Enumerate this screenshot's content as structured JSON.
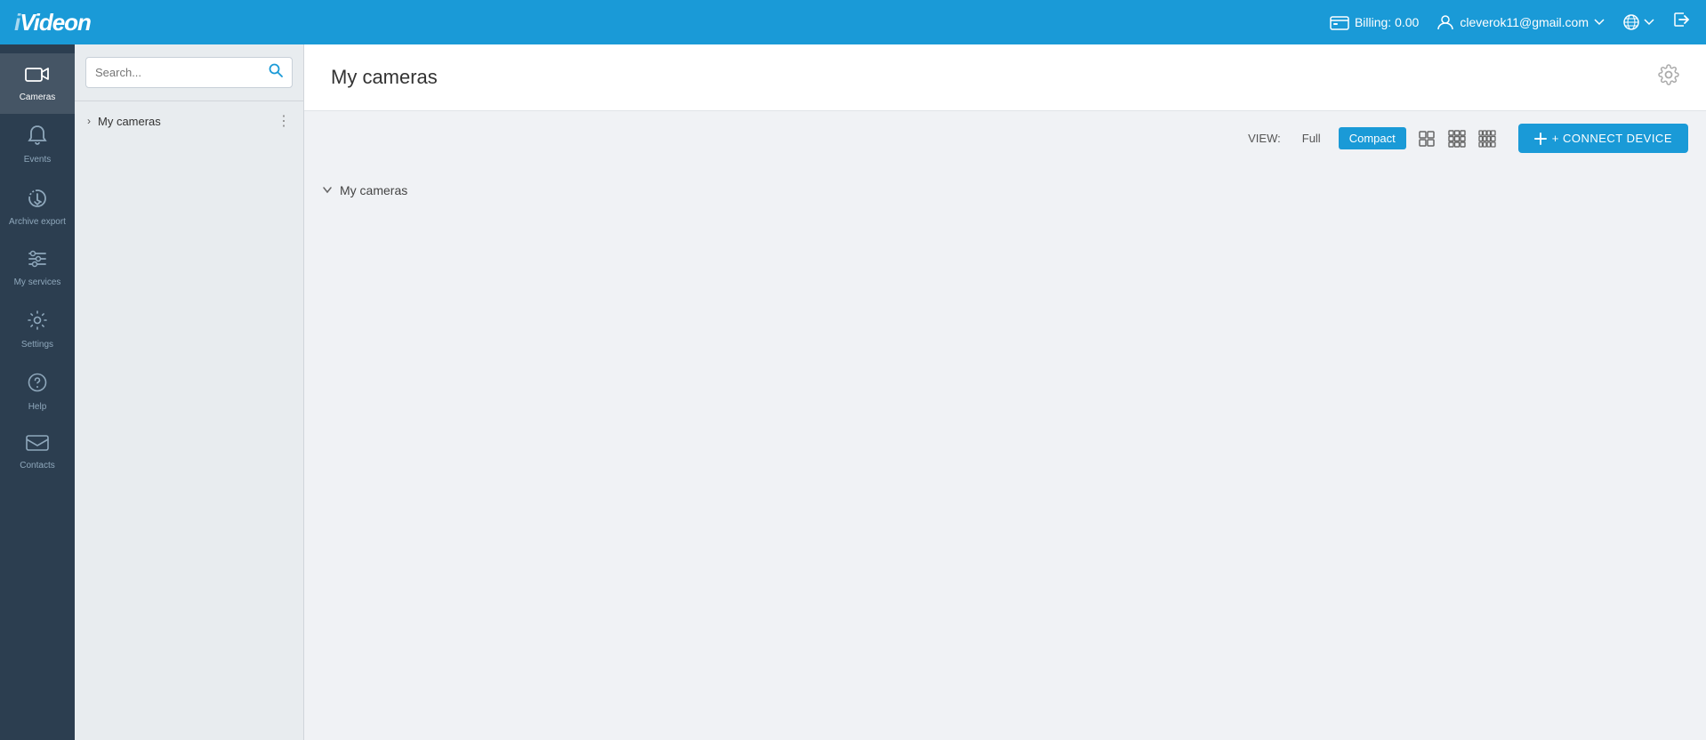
{
  "app": {
    "name": "ivideon",
    "logo_i": "i",
    "logo_rest": "Videon"
  },
  "header": {
    "billing_label": "Billing: 0.00",
    "user_email": "cleverok11@gmail.com",
    "language_icon": "globe",
    "logout_icon": "logout"
  },
  "sidebar": {
    "items": [
      {
        "id": "cameras",
        "label": "Cameras",
        "icon": "camera",
        "active": true
      },
      {
        "id": "events",
        "label": "Events",
        "icon": "bell",
        "active": false
      },
      {
        "id": "archive-export",
        "label": "Archive export",
        "icon": "cloud",
        "active": false
      },
      {
        "id": "my-services",
        "label": "My services",
        "icon": "sliders",
        "active": false
      },
      {
        "id": "settings",
        "label": "Settings",
        "icon": "gear",
        "active": false
      },
      {
        "id": "help",
        "label": "Help",
        "icon": "help",
        "active": false
      },
      {
        "id": "contacts",
        "label": "Contacts",
        "icon": "mail",
        "active": false
      }
    ]
  },
  "camera_panel": {
    "search_placeholder": "Search...",
    "group": {
      "title": "My cameras",
      "chevron": "›"
    }
  },
  "main": {
    "title": "My cameras",
    "view": {
      "label": "VIEW:",
      "full_label": "Full",
      "compact_label": "Compact",
      "active": "compact"
    },
    "connect_button": "+ CONNECT DEVICE",
    "cameras_group": {
      "title": "My cameras",
      "chevron": "›"
    }
  },
  "colors": {
    "primary": "#1a9ad7",
    "sidebar_bg": "#2c3e50",
    "header_bg": "#1a9ad7"
  }
}
